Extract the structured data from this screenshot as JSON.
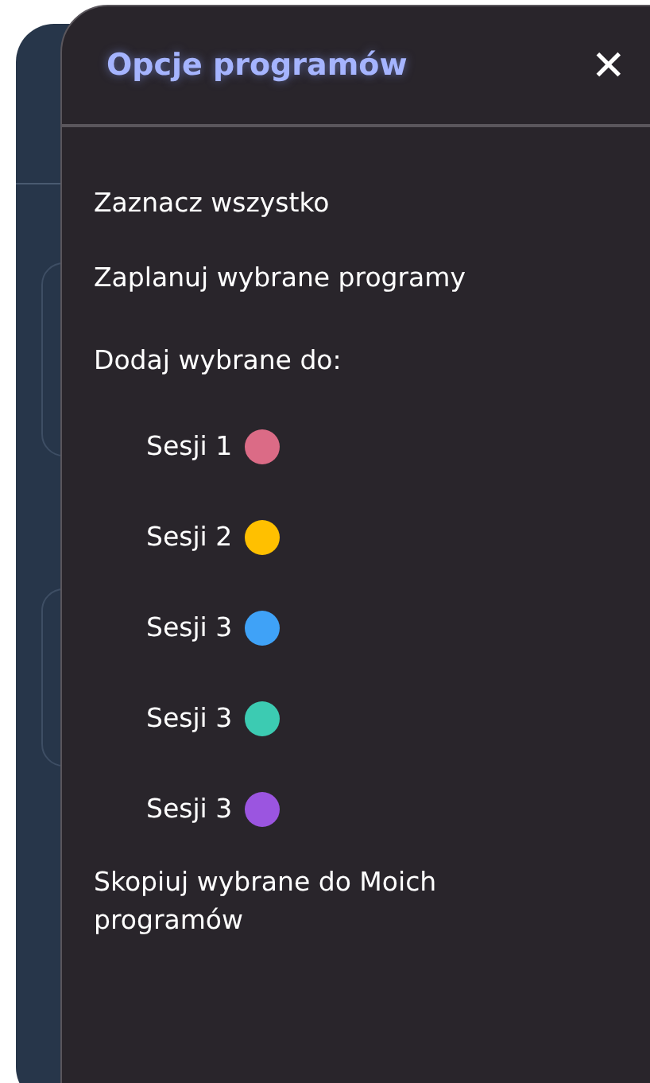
{
  "drawer": {
    "title": "Opcje programów",
    "close": "✕"
  },
  "actions": [
    {
      "label": "Zaznacz wszystko"
    },
    {
      "label": "Zaplanuj wybrane programy"
    }
  ],
  "add_to": {
    "label": "Dodaj wybrane do:",
    "sessions": [
      {
        "label": "Sesji 1",
        "color": "#db6b86"
      },
      {
        "label": "Sesji 2",
        "color": "#ffc000"
      },
      {
        "label": "Sesji 3",
        "color": "#3fa2f7"
      },
      {
        "label": "Sesji 3",
        "color": "#3ccbb2"
      },
      {
        "label": "Sesji 3",
        "color": "#9b55e0"
      }
    ]
  },
  "copy": {
    "label": "Skopiuj wybrane do Moich programów"
  }
}
